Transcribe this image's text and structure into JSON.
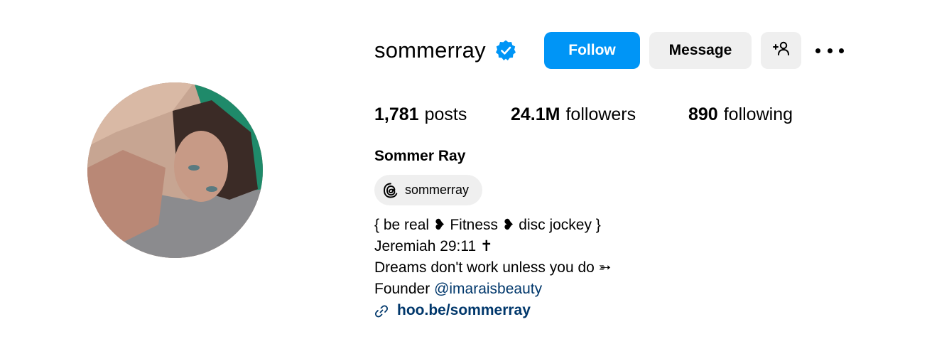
{
  "profile": {
    "username": "sommerray",
    "full_name": "Sommer Ray",
    "verified_icon": "verified-badge-icon",
    "accent_color": "#0095f6",
    "link_color": "#00376b"
  },
  "actions": {
    "follow_label": "Follow",
    "message_label": "Message",
    "add_user_icon": "add-user-icon",
    "more_icon": "more-options-icon"
  },
  "stats": {
    "posts_count": "1,781",
    "posts_label": "posts",
    "followers_count": "24.1M",
    "followers_label": "followers",
    "following_count": "890",
    "following_label": "following"
  },
  "threads": {
    "icon": "threads-icon",
    "handle": "sommerray"
  },
  "bio": {
    "line1": "{ be real ❥ Fitness ❥ disc jockey }",
    "line2": "Jeremiah 29:11 ✝",
    "line3": "Dreams don't work unless you do ➳",
    "line4_prefix": "Founder ",
    "line4_mention": "@imaraisbeauty",
    "link_icon": "link-icon",
    "link_text": "hoo.be/sommerray"
  }
}
